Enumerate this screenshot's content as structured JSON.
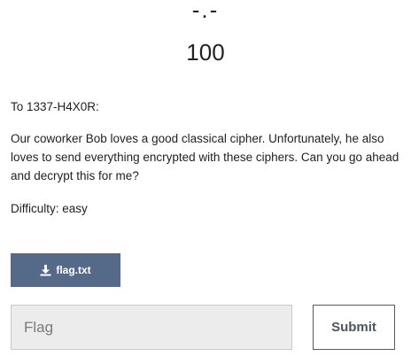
{
  "challenge": {
    "name": "-.-",
    "value": "100",
    "description": {
      "greeting": "To 1337-H4X0R:",
      "body": "Our coworker Bob loves a good classical cipher. Unfortunately, he also loves to send everything encrypted with these ciphers. Can you go ahead and decrypt this for me?",
      "difficulty": "Difficulty: easy"
    }
  },
  "file": {
    "label": "flag.txt",
    "icon": "download-icon"
  },
  "form": {
    "flag_value": "",
    "flag_placeholder": "Flag",
    "submit_label": "Submit"
  },
  "colors": {
    "file_button": "#556a89",
    "input_background": "#ececec"
  }
}
